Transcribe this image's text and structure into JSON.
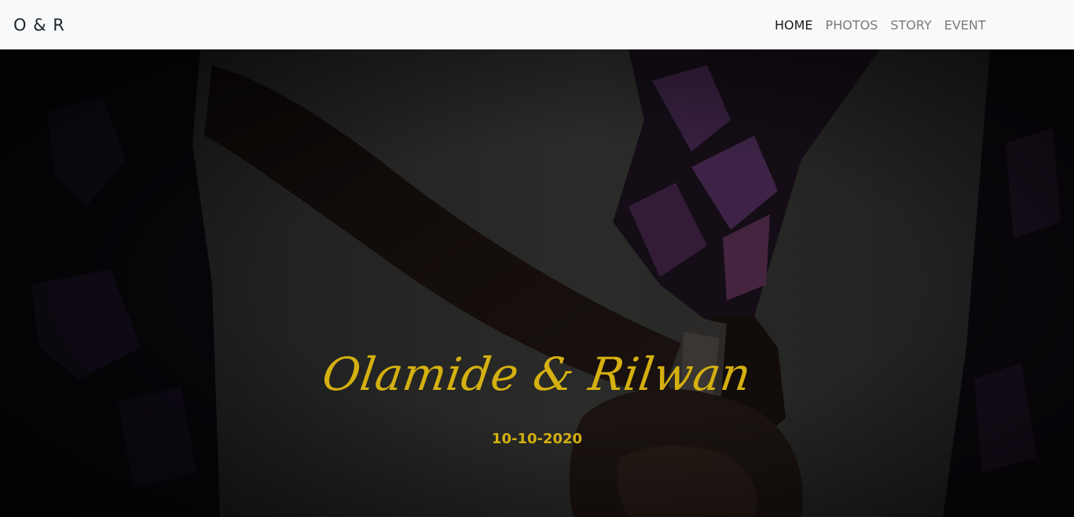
{
  "navbar": {
    "brand": "O & R",
    "links": [
      {
        "label": "HOME",
        "active": true
      },
      {
        "label": "PHOTOS",
        "active": false
      },
      {
        "label": "STORY",
        "active": false
      },
      {
        "label": "EVENT",
        "active": false
      }
    ]
  },
  "hero": {
    "names": "Olamide & Rilwan",
    "date": "10-10-2020",
    "accent_color": "#d4b010"
  }
}
